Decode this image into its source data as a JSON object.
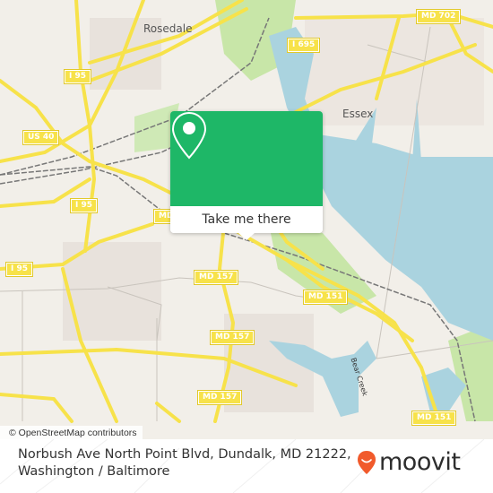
{
  "map": {
    "places": [
      {
        "id": "rosedale",
        "label": "Rosedale"
      },
      {
        "id": "essex",
        "label": "Essex"
      }
    ],
    "water_labels": [
      {
        "id": "bear-creek",
        "label": "Bear Creek"
      }
    ],
    "road_shields": [
      {
        "id": "md702",
        "label": "MD 702"
      },
      {
        "id": "i695",
        "label": "I 695"
      },
      {
        "id": "i95-top",
        "label": "I 95"
      },
      {
        "id": "us40",
        "label": "US 40"
      },
      {
        "id": "i95-mid",
        "label": "I 95"
      },
      {
        "id": "i95-left",
        "label": "I 95"
      },
      {
        "id": "md-partial",
        "label": "MD"
      },
      {
        "id": "md157-a",
        "label": "MD 157"
      },
      {
        "id": "md157-b",
        "label": "MD 157"
      },
      {
        "id": "md157-c",
        "label": "MD 157"
      },
      {
        "id": "md151-a",
        "label": "MD 151"
      },
      {
        "id": "md151-b",
        "label": "MD 151"
      }
    ],
    "attribution": "© OpenStreetMap contributors",
    "colors": {
      "land": "#f2efe9",
      "water": "#aad3df",
      "park": "#c8e6a8",
      "road": "#f7e24a",
      "rail": "#777777"
    }
  },
  "popup": {
    "icon": "location-pin-icon",
    "action_label": "Take me there",
    "color": "#1eb767"
  },
  "footer": {
    "address_line1": "Norbush Ave North Point Blvd, Dundalk, MD 21222,",
    "address_line2": "Washington / Baltimore",
    "brand": "moovit",
    "brand_color": "#f15a2b"
  }
}
